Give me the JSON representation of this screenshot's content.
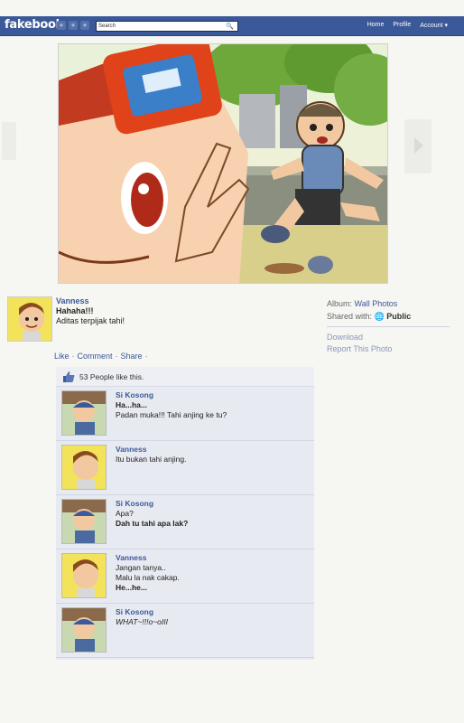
{
  "topbar": {
    "brand": "fakebook",
    "search_placeholder": "Search",
    "nav": [
      "Home",
      "Profile",
      "Account"
    ]
  },
  "post": {
    "author": "Vanness",
    "line1": "Hahaha!!!",
    "line2": "Aditas terpijak tahi!"
  },
  "actions": {
    "like": "Like",
    "comment": "Comment",
    "share": "Share"
  },
  "sidebar": {
    "album_label": "Album:",
    "album_value": "Wall Photos",
    "shared_label": "Shared with:",
    "shared_value": "Public",
    "download": "Download",
    "report": "Report This Photo"
  },
  "likes_text": "53 People like this.",
  "comments": [
    {
      "author": "Si Kosong",
      "lines": [
        "Ha...ha...",
        "Padan muka!!! Tahi anjing ke tu?"
      ]
    },
    {
      "author": "Vanness",
      "lines": [
        "Itu bukan tahi anjing."
      ]
    },
    {
      "author": "Si Kosong",
      "lines": [
        "Apa?",
        "Dah tu tahi apa lak?"
      ]
    },
    {
      "author": "Vanness",
      "lines": [
        "Jangan tanya..",
        "Malu la nak cakap.",
        "He...he..."
      ]
    },
    {
      "author": "Si Kosong",
      "lines": [
        "WHAT~!!!o~oIII"
      ]
    }
  ],
  "colors": {
    "brand_blue": "#3b5998",
    "comment_bg": "#e8eaf1"
  }
}
